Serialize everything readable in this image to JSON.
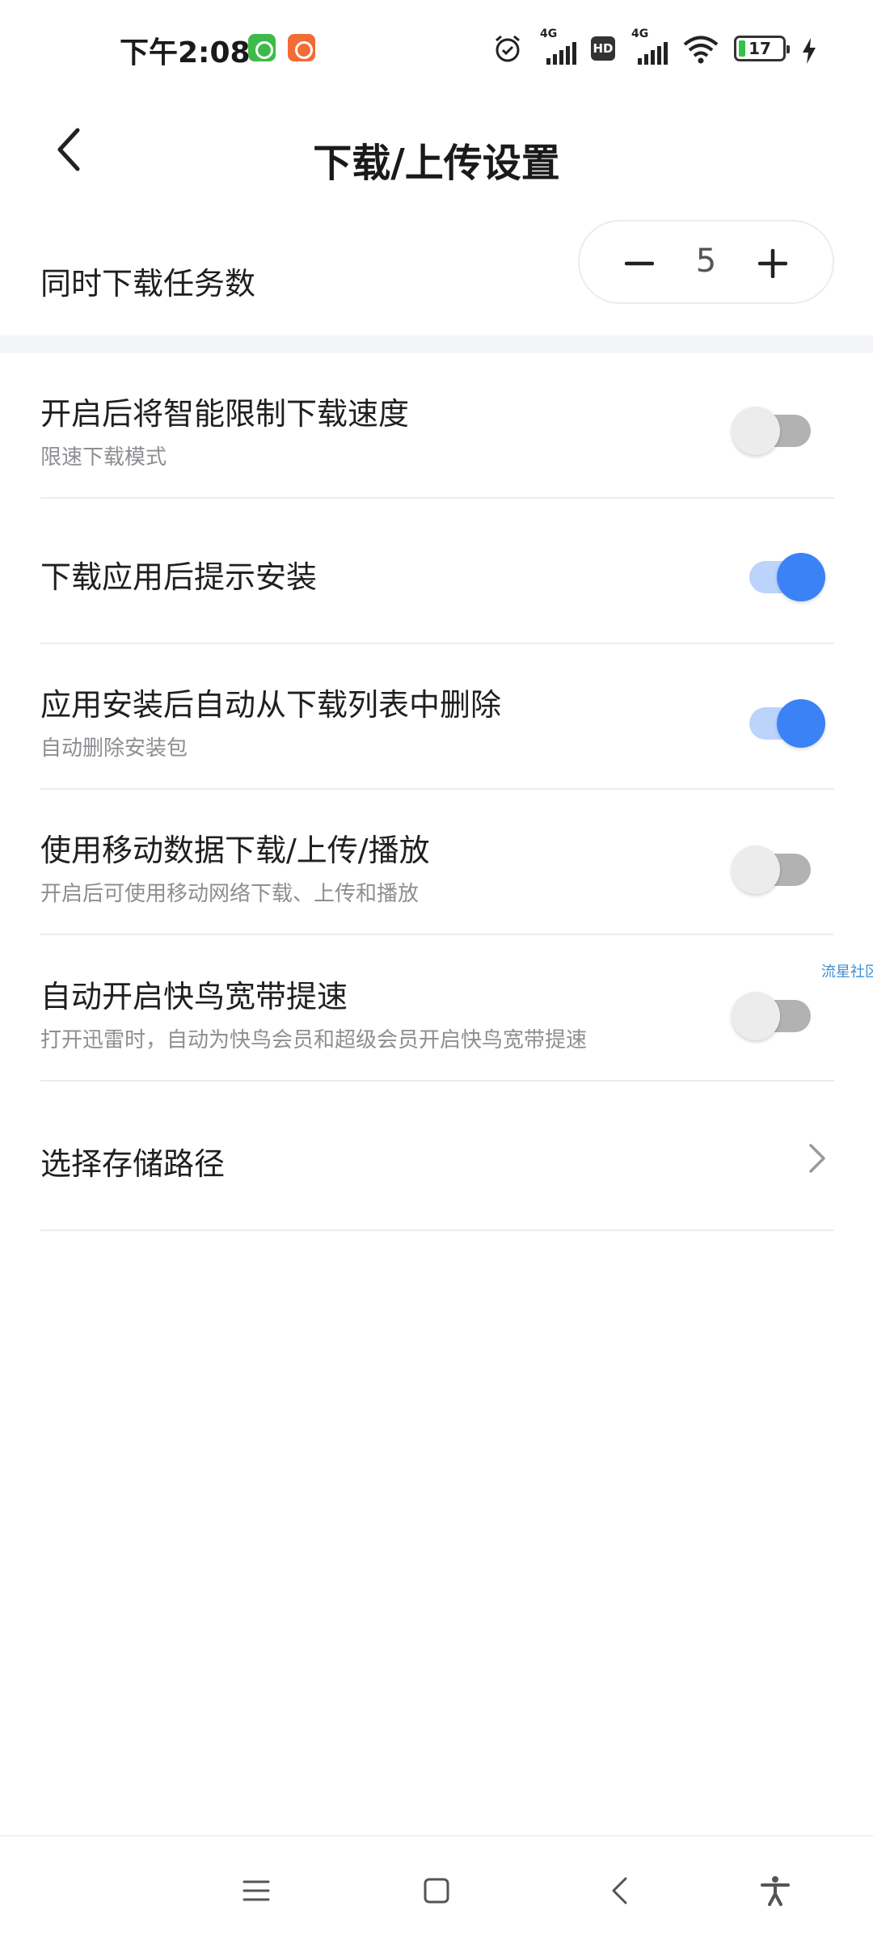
{
  "status_bar": {
    "time": "下午2:08",
    "network_1": "4G",
    "hd": "HD",
    "network_2": "4G",
    "battery": "17"
  },
  "header": {
    "title": "下载/上传设置"
  },
  "concurrent": {
    "label": "同时下载任务数",
    "value": "5"
  },
  "settings": [
    {
      "title": "开启后将智能限制下载速度",
      "subtitle": "限速下载模式",
      "enabled": false
    },
    {
      "title": "下载应用后提示安装",
      "subtitle": "",
      "enabled": true
    },
    {
      "title": "应用安装后自动从下载列表中删除",
      "subtitle": "自动删除安装包",
      "enabled": true
    },
    {
      "title": "使用移动数据下载/上传/播放",
      "subtitle": "开启后可使用移动网络下载、上传和播放",
      "enabled": false
    },
    {
      "title": "自动开启快鸟宽带提速",
      "subtitle": "打开迅雷时，自动为快鸟会员和超级会员开启快鸟宽带提速",
      "enabled": false
    }
  ],
  "storage": {
    "label": "选择存储路径"
  },
  "watermark": "流星社区",
  "colors": {
    "accent": "#3b82f6",
    "toggle_off_track": "#b2b2b2",
    "section_gap": "#f3f5f8"
  }
}
